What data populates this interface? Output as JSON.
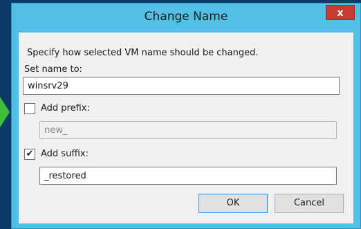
{
  "dialog": {
    "title": "Change Name",
    "close_glyph": "x",
    "instruction": "Specify how selected VM name should be changed.",
    "set_name_label": "Set name to:",
    "set_name_value": "winsrv29",
    "prefix": {
      "label": "Add prefix:",
      "checked": false,
      "value": "new_"
    },
    "suffix": {
      "label": "Add suffix:",
      "checked": true,
      "value": "_restored"
    },
    "ok_label": "OK",
    "cancel_label": "Cancel"
  },
  "colors": {
    "frame": "#52bfe6",
    "close_button": "#c73b30",
    "backdrop": "#0d3a66"
  }
}
